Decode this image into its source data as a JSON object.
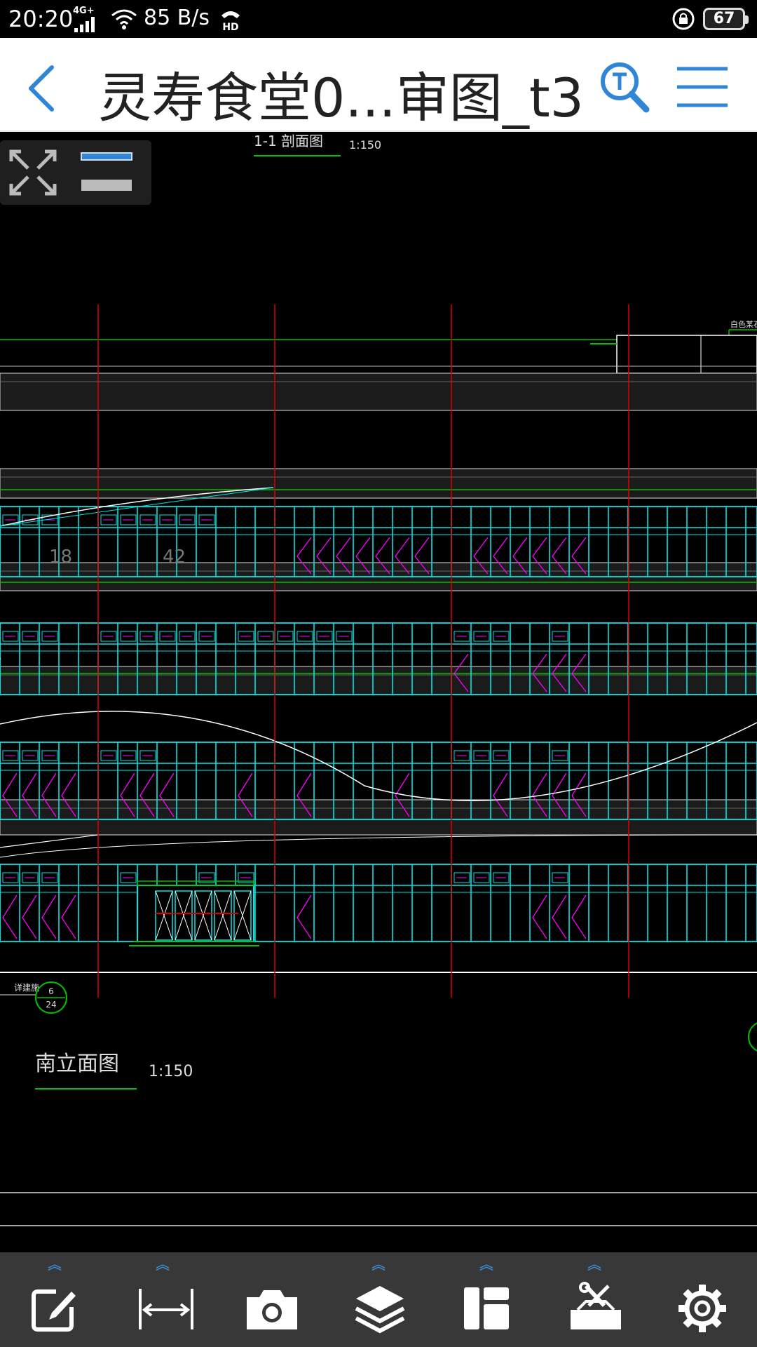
{
  "status_bar": {
    "time": "20:20",
    "network": "4G+",
    "speed": "85 B/s",
    "hd_badge": "HD",
    "battery": "67"
  },
  "header": {
    "title": "灵寿食堂0...审图_t3",
    "back_icon": "chevron-left-icon",
    "search_icon": "text-search-icon",
    "menu_icon": "hamburger-menu-icon",
    "accent_color": "#2f86d6"
  },
  "drawing": {
    "section_title": "1-1  剖面图",
    "section_scale": "1:150",
    "elevation_title": "南立面图",
    "elevation_scale": "1:150",
    "note_top_right": "白色某石涂",
    "detail_note": "详建施",
    "detail_circle_top": "6",
    "detail_circle_bottom": "24",
    "dim_a": "18",
    "dim_b": "42",
    "colors": {
      "window": "#00e5e5",
      "axis": "#e00000",
      "level": "#00c000",
      "annotation": "#ff00ff",
      "outline": "#ffffff"
    }
  },
  "zoom_panel": {
    "fit_icon": "fit-screen-icon",
    "zoom_in_icon": "zoom-in-icon",
    "zoom_out_icon": "zoom-out-icon"
  },
  "toolbar": {
    "items": [
      {
        "name": "annotate",
        "icon": "edit-icon"
      },
      {
        "name": "measure",
        "icon": "measure-icon"
      },
      {
        "name": "screenshot",
        "icon": "camera-icon"
      },
      {
        "name": "layers",
        "icon": "layers-icon"
      },
      {
        "name": "layout",
        "icon": "layout-icon"
      },
      {
        "name": "tools",
        "icon": "toolbox-icon"
      },
      {
        "name": "settings",
        "icon": "gear-icon"
      }
    ]
  }
}
